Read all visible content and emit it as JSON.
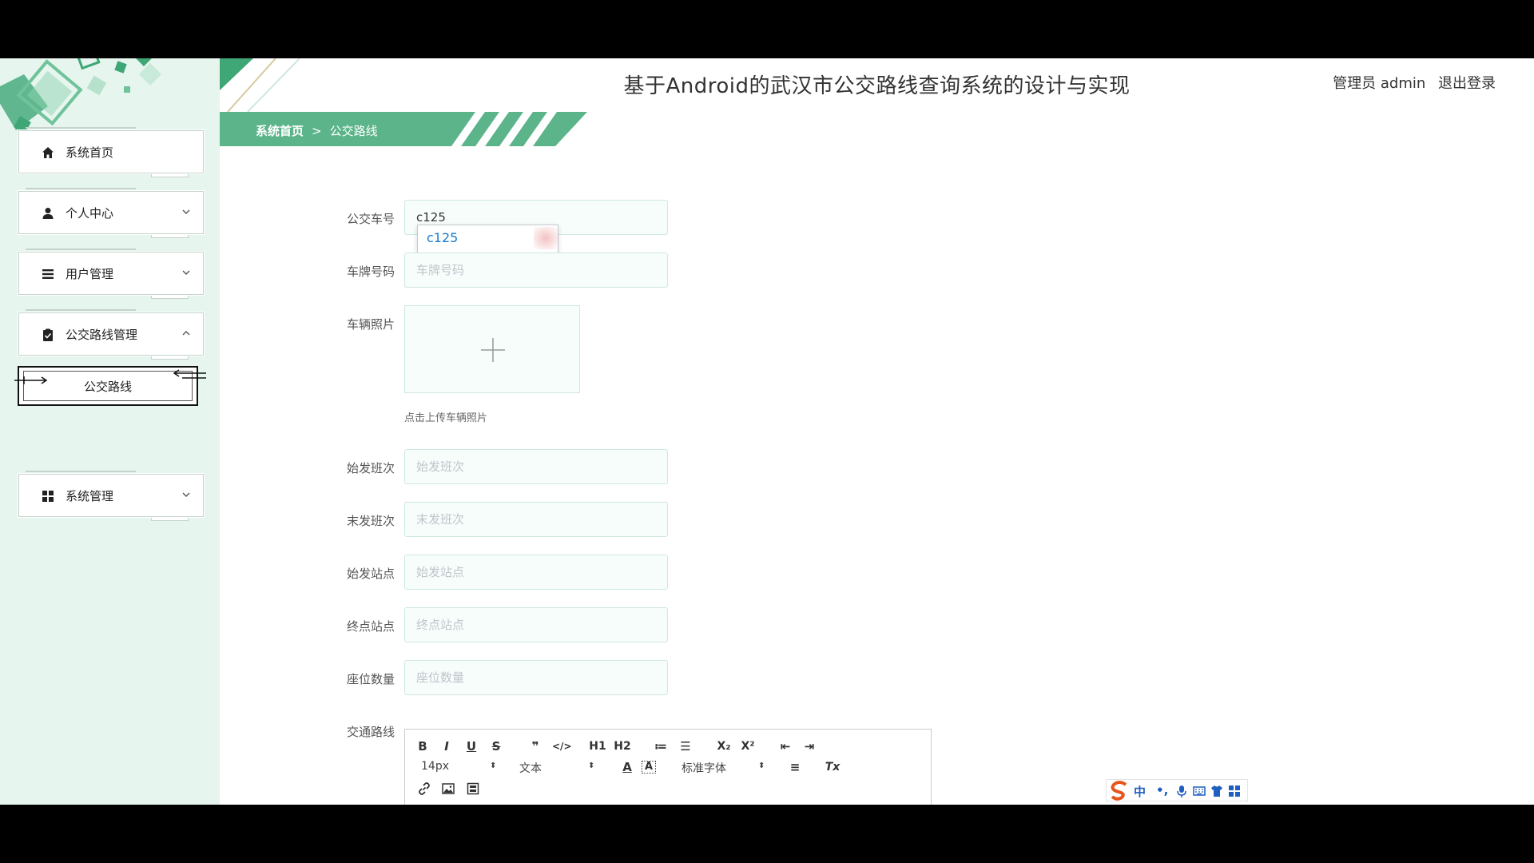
{
  "app": {
    "title": "基于Android的武汉市公交路线查询系统的设计与实现",
    "user_role": "管理员 admin",
    "logout_label": "退出登录"
  },
  "breadcrumb": {
    "home": "系统首页",
    "separator": ">",
    "current": "公交路线"
  },
  "sidebar": {
    "items": [
      {
        "label": "系统首页",
        "icon": "home-icon"
      },
      {
        "label": "个人中心",
        "icon": "user-icon"
      },
      {
        "label": "用户管理",
        "icon": "list-icon"
      },
      {
        "label": "公交路线管理",
        "icon": "clipboard-icon"
      },
      {
        "label": "系统管理",
        "icon": "grid-icon"
      }
    ],
    "sub_items": [
      {
        "label": "公交路线"
      }
    ]
  },
  "form": {
    "bus_no": {
      "label": "公交车号",
      "value": "c125"
    },
    "plate": {
      "label": "车牌号码",
      "placeholder": "车牌号码"
    },
    "photo": {
      "label": "车辆照片",
      "tip": "点击上传车辆照片"
    },
    "first_run": {
      "label": "始发班次",
      "placeholder": "始发班次"
    },
    "last_run": {
      "label": "末发班次",
      "placeholder": "末发班次"
    },
    "start_station": {
      "label": "始发站点",
      "placeholder": "始发站点"
    },
    "end_station": {
      "label": "终点站点",
      "placeholder": "终点站点"
    },
    "seats": {
      "label": "座位数量",
      "placeholder": "座位数量"
    },
    "route": {
      "label": "交通路线"
    }
  },
  "autocomplete": {
    "option": "c125"
  },
  "editor": {
    "row1": [
      "B",
      "I",
      "U",
      "S",
      "❞",
      "</>",
      "H1",
      "H2",
      "≔",
      "☰",
      "X₂",
      "X²",
      "⇤",
      "⇥"
    ],
    "font_size": "14px",
    "text_type": "文本",
    "font_family": "标准字体",
    "align": "≡",
    "clear": "Tx"
  },
  "ime": {
    "text": "中",
    "punct": "•,"
  },
  "colors": {
    "accent": "#3fa675",
    "sidebar_bg": "#e6f5ee",
    "input_bg": "#f7fdfa",
    "link": "#1a7acb"
  }
}
